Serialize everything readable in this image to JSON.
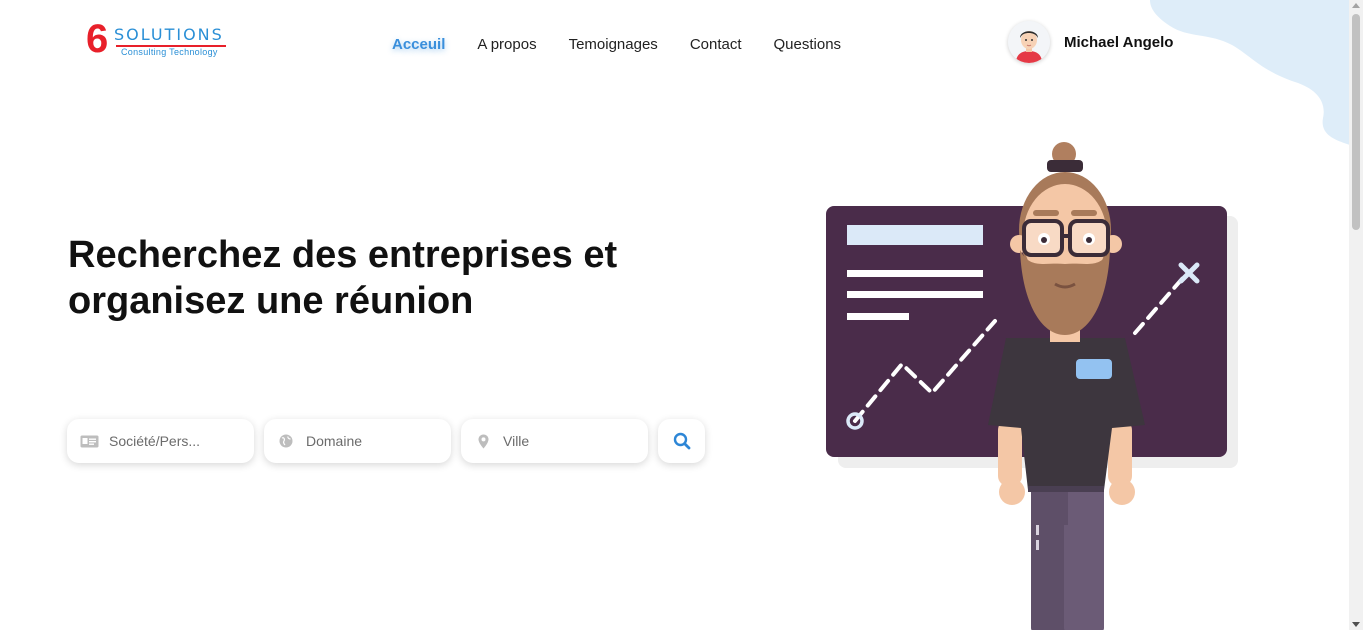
{
  "header": {
    "logo": {
      "mark": "6",
      "word": "SOLUTIONS",
      "tagline": "Consulting Technology"
    },
    "nav": [
      {
        "label": "Acceuil",
        "active": true
      },
      {
        "label": "A propos",
        "active": false
      },
      {
        "label": "Temoignages",
        "active": false
      },
      {
        "label": "Contact",
        "active": false
      },
      {
        "label": "Questions",
        "active": false
      }
    ],
    "user": {
      "name": "Michael Angelo"
    }
  },
  "hero": {
    "title_line1": "Recherchez des entreprises et",
    "title_line2": "organisez une réunion"
  },
  "search": {
    "company_placeholder": "Société/Pers...",
    "domain_placeholder": "Domaine",
    "city_placeholder": "Ville",
    "icons": [
      "id-card-icon",
      "globe-icon",
      "map-pin-icon",
      "search-icon"
    ]
  },
  "colors": {
    "accent": "#3a8fdc",
    "brand_red": "#e8202a",
    "board": "#4a2c4a",
    "blob": "#deedf9"
  }
}
